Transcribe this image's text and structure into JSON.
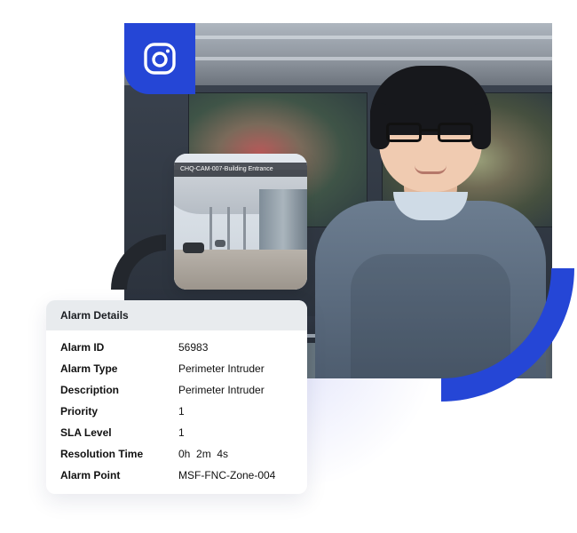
{
  "colors": {
    "brand_blue": "#2546d6",
    "dark_arc": "#23272d",
    "card_header_bg": "#e8ebee"
  },
  "camera_badge": {
    "icon": "camera-icon"
  },
  "camera_feed": {
    "label": "CHQ-CAM-007-Building Entrance"
  },
  "alarm_details": {
    "title": "Alarm Details",
    "rows": [
      {
        "key": "Alarm ID",
        "value": "56983"
      },
      {
        "key": "Alarm Type",
        "value": "Perimeter Intruder"
      },
      {
        "key": "Description",
        "value": "Perimeter Intruder"
      },
      {
        "key": "Priority",
        "value": "1"
      },
      {
        "key": "SLA Level",
        "value": "1"
      },
      {
        "key": "Resolution Time",
        "value": "0h  2m  4s"
      },
      {
        "key": "Alarm Point",
        "value": "MSF-FNC-Zone-004"
      }
    ]
  }
}
